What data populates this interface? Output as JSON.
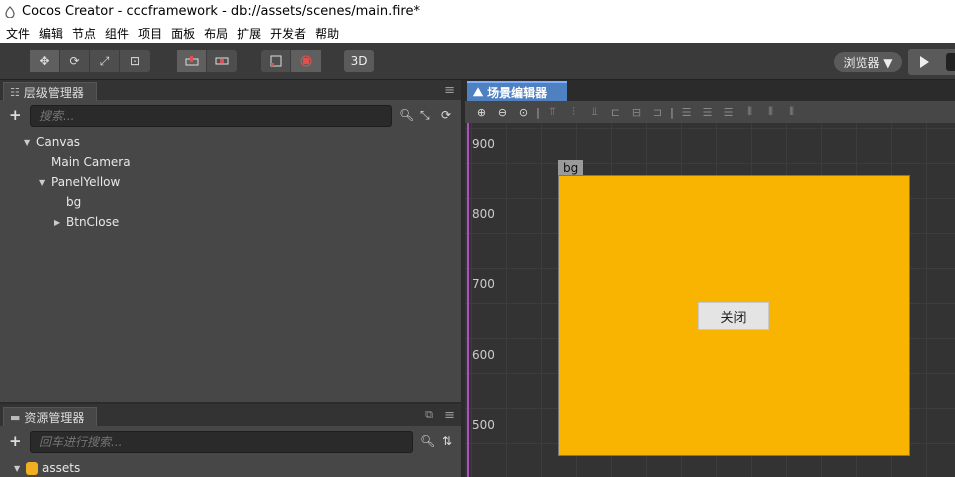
{
  "window": {
    "title": "Cocos Creator - cccframework - db://assets/scenes/main.fire*"
  },
  "menu": [
    "文件",
    "编辑",
    "节点",
    "组件",
    "项目",
    "面板",
    "布局",
    "扩展",
    "开发者",
    "帮助"
  ],
  "toolbar": {
    "btn_3d": "3D",
    "browser": "浏览器 ▼"
  },
  "hierarchy": {
    "tab": "层级管理器",
    "search_placeholder": "搜索...",
    "tree": [
      {
        "label": "Canvas",
        "level": 0,
        "expanded": true
      },
      {
        "label": "Main Camera",
        "level": 1
      },
      {
        "label": "PanelYellow",
        "level": 1,
        "expanded": true
      },
      {
        "label": "bg",
        "level": 2
      },
      {
        "label": "BtnClose",
        "level": 2,
        "expanded": false
      }
    ]
  },
  "assets": {
    "tab": "资源管理器",
    "search_placeholder": "回车进行搜索...",
    "root": "assets"
  },
  "scene": {
    "tab": "场景编辑器",
    "y_labels": [
      "900",
      "800",
      "700",
      "600",
      "500"
    ],
    "node_label": "bg",
    "button_label": "关闭",
    "colors": {
      "bg": "#f8b400",
      "tab": "#4f80c0"
    }
  }
}
